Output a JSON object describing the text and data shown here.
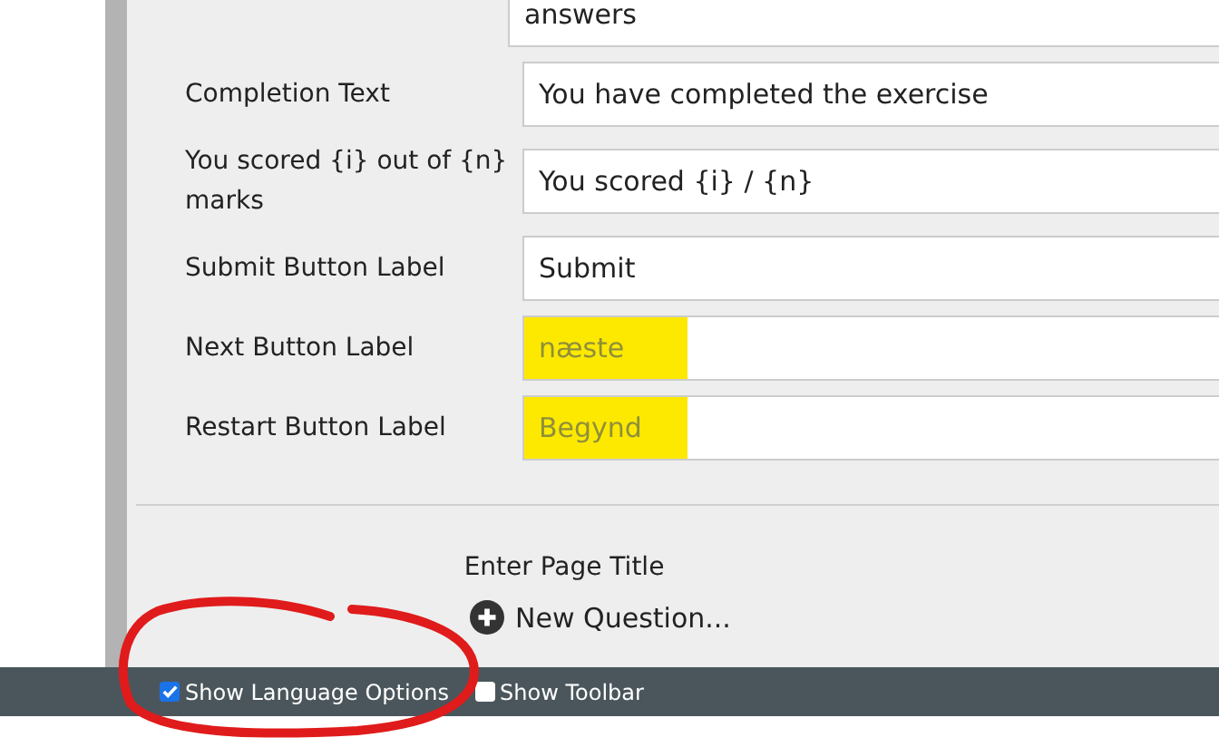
{
  "fields": [
    {
      "value": "answers",
      "highlighted": false
    },
    {
      "label": "Completion Text",
      "value": "You have completed the exercise",
      "highlighted": false
    },
    {
      "label": "You scored {i} out of {n} marks",
      "value": "You scored {i} / {n}",
      "highlighted": false
    },
    {
      "label": "Submit Button Label",
      "value": "Submit",
      "highlighted": false
    },
    {
      "label": "Next Button Label",
      "placeholder": "næste",
      "highlighted": true
    },
    {
      "label": "Restart Button Label",
      "placeholder": "Begynd",
      "highlighted": true
    }
  ],
  "page_title": "Enter Page Title",
  "new_question": "New Question...",
  "options": [
    {
      "label": "Show Language Options",
      "checked": true
    },
    {
      "label": "Show Toolbar",
      "checked": false
    }
  ]
}
